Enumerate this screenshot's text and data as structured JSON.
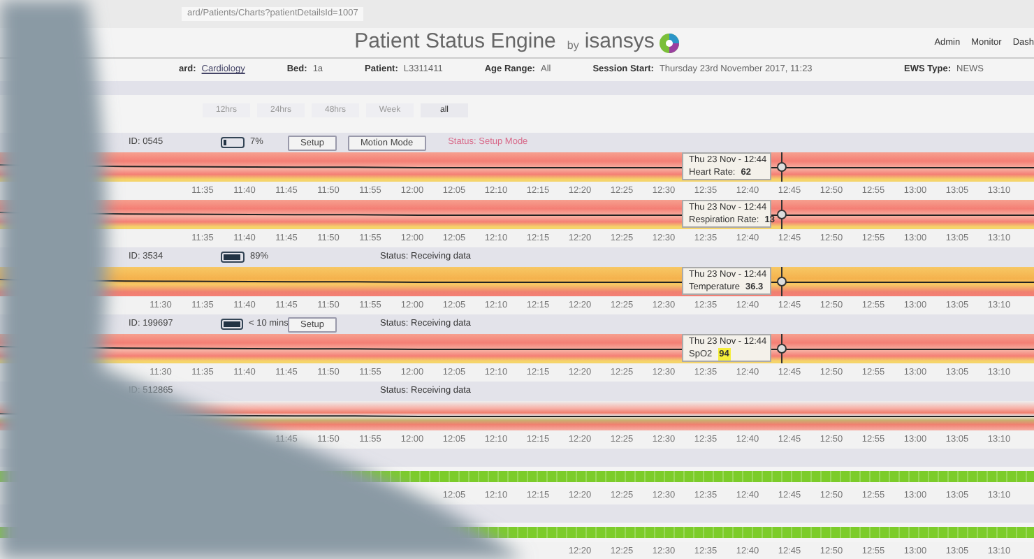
{
  "address_bar": {
    "url": "ard/Patients/Charts?patientDetailsId=1007"
  },
  "header": {
    "title": "Patient Status Engine",
    "by": "by",
    "brand": "isansys",
    "nav": [
      "Admin",
      "Monitor",
      "Dash"
    ]
  },
  "info": [
    {
      "label": "ard:",
      "value": "Cardiology",
      "link": true
    },
    {
      "label": "Bed:",
      "value": "1a",
      "link": false
    },
    {
      "label": "Patient:",
      "value": "L3311411",
      "link": false
    },
    {
      "label": "Age Range:",
      "value": "All",
      "link": false
    },
    {
      "label": "Session Start:",
      "value": "Thursday 23rd November 2017, 11:23",
      "link": false
    },
    {
      "label": "EWS Type:",
      "value": "NEWS",
      "link": false
    }
  ],
  "ranges": [
    {
      "label": "12hrs",
      "selected": false
    },
    {
      "label": "24hrs",
      "selected": false
    },
    {
      "label": "48hrs",
      "selected": false
    },
    {
      "label": "Week",
      "selected": false
    },
    {
      "label": "all",
      "selected": true
    }
  ],
  "panels": [
    {
      "kind": "device",
      "id": "ID: 0545",
      "charged": false,
      "battery": "7%",
      "buttons": [
        "Setup",
        "Motion Mode"
      ],
      "status": "Status: Setup Mode",
      "status_alert": true
    },
    {
      "kind": "vital",
      "warning": false,
      "tooltip": {
        "date": "Thu 23 Nov - 12:44",
        "label": "Heart Rate:",
        "value": "62",
        "highlight": false
      }
    },
    {
      "kind": "axis",
      "ticks": [
        "11:35",
        "11:40",
        "11:45",
        "11:50",
        "11:55",
        "12:00",
        "12:05",
        "12:10",
        "12:15",
        "12:20",
        "12:25",
        "12:30",
        "12:35",
        "12:40",
        "12:45",
        "12:50",
        "12:55",
        "13:00",
        "13:05",
        "13:10"
      ]
    },
    {
      "kind": "vital",
      "warning": false,
      "tooltip": {
        "date": "Thu 23 Nov - 12:44",
        "label": "Respiration Rate:",
        "value": "13",
        "highlight": false
      }
    },
    {
      "kind": "axis",
      "ticks": [
        "11:35",
        "11:40",
        "11:45",
        "11:50",
        "11:55",
        "12:00",
        "12:05",
        "12:10",
        "12:15",
        "12:20",
        "12:25",
        "12:30",
        "12:35",
        "12:40",
        "12:45",
        "12:50",
        "12:55",
        "13:00",
        "13:05",
        "13:10"
      ]
    },
    {
      "kind": "device",
      "id": "ID: 3534",
      "charged": true,
      "battery": "89%",
      "status": "Status: Receiving data",
      "status_alert": false
    },
    {
      "kind": "vital",
      "warning": true,
      "tooltip": {
        "date": "Thu 23 Nov - 12:44",
        "label": "Temperature",
        "value": "36.3",
        "highlight": false
      }
    },
    {
      "kind": "axis",
      "ticks": [
        "11:30",
        "11:35",
        "11:40",
        "11:45",
        "11:50",
        "11:55",
        "12:00",
        "12:05",
        "12:10",
        "12:15",
        "12:20",
        "12:25",
        "12:30",
        "12:35",
        "12:40",
        "12:45",
        "12:50",
        "12:55",
        "13:00",
        "13:05",
        "13:10"
      ]
    },
    {
      "kind": "device",
      "id": "ID: 199697",
      "charged": true,
      "battery": "< 10 mins",
      "buttons": [
        "Setup"
      ],
      "status": "Status: Receiving data",
      "status_alert": false
    },
    {
      "kind": "vital",
      "warning": false,
      "tooltip": {
        "date": "Thu 23 Nov - 12:44",
        "label": "SpO2",
        "value": "94",
        "highlight": true
      }
    },
    {
      "kind": "axis",
      "ticks": [
        "11:30",
        "11:35",
        "11:40",
        "11:45",
        "11:50",
        "11:55",
        "12:00",
        "12:05",
        "12:10",
        "12:15",
        "12:20",
        "12:25",
        "12:30",
        "12:35",
        "12:40",
        "12:45",
        "12:50",
        "12:55",
        "13:00",
        "13:05",
        "13:10"
      ]
    },
    {
      "kind": "device",
      "id": "ID: 512865",
      "status": "Status: Receiving data",
      "status_alert": false
    },
    {
      "kind": "pressure"
    },
    {
      "kind": "axis",
      "ticks": [
        "11:45",
        "11:50",
        "11:55",
        "12:00",
        "12:05",
        "12:10",
        "12:15",
        "12:20",
        "12:25",
        "12:30",
        "12:35",
        "12:40",
        "12:45",
        "12:50",
        "12:55",
        "13:00",
        "13:05",
        "13:10"
      ]
    },
    {
      "kind": "gap"
    },
    {
      "kind": "activity"
    },
    {
      "kind": "axis",
      "ticks": [
        "12:05",
        "12:10",
        "12:15",
        "12:20",
        "12:25",
        "12:30",
        "12:35",
        "12:40",
        "12:45",
        "12:50",
        "12:55",
        "13:00",
        "13:05",
        "13:10"
      ]
    },
    {
      "kind": "gap"
    },
    {
      "kind": "activity"
    },
    {
      "kind": "axis",
      "ticks": [
        "12:20",
        "12:25",
        "12:30",
        "12:35",
        "12:40",
        "12:45",
        "12:50",
        "12:55",
        "13:00",
        "13:05",
        "13:10"
      ]
    }
  ]
}
